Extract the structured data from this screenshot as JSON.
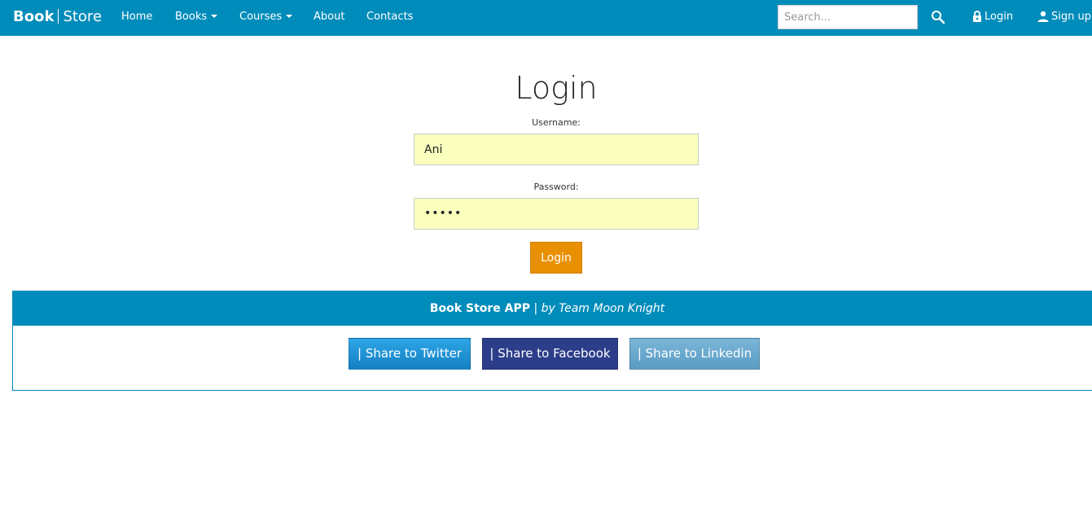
{
  "navbar": {
    "brand_bold": "Book",
    "brand_light": "Store",
    "links": {
      "home": "Home",
      "books": "Books",
      "courses": "Courses",
      "about": "About",
      "contacts": "Contacts"
    },
    "search_placeholder": "Search...",
    "login": "Login",
    "signup": "Sign up"
  },
  "form": {
    "title": "Login",
    "username_label": "Username:",
    "username_value": "Ani",
    "password_label": "Password:",
    "password_mask": "•••••",
    "submit": "Login"
  },
  "footer": {
    "app_name": "Book Store APP",
    "separator": "|",
    "byline": "by Team Moon Knight",
    "share_twitter": "| Share to Twitter",
    "share_facebook": "| Share to Facebook",
    "share_linkedin": "| Share to Linkedin"
  },
  "colors": {
    "primary": "#008cba",
    "warning": "#e99002",
    "autofill": "#faffbd",
    "twitter": "#1d8fd6",
    "facebook": "#2c3e8a",
    "linkedin": "#6aaad0"
  },
  "icons": {
    "search": "search-icon",
    "login": "lock-icon",
    "signup": "user-icon",
    "dropdown": "caret-down-icon"
  }
}
